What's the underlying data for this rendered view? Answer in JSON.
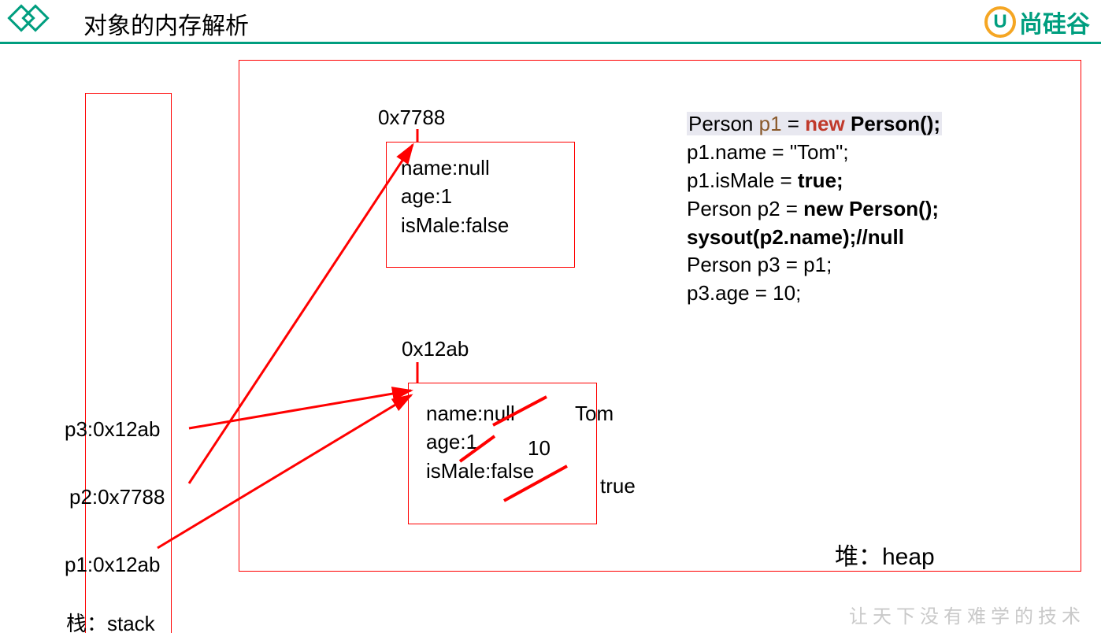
{
  "header": {
    "title": "对象的内存解析",
    "brand": "尚硅谷",
    "brand_letter": "U"
  },
  "stack": {
    "label": "栈：stack",
    "vars": {
      "p3": "p3:0x12ab",
      "p2": "p2:0x7788",
      "p1": "p1:0x12ab"
    }
  },
  "heap": {
    "label": "堆：heap",
    "obj1": {
      "addr": "0x7788",
      "name": "name:null",
      "age": "age:1",
      "isMale": "isMale:false"
    },
    "obj2": {
      "addr": "0x12ab",
      "name": "name:null",
      "age": "age:1",
      "isMale": "isMale:false",
      "name_new": "Tom",
      "age_new": "10",
      "isMale_new": "true"
    }
  },
  "code": {
    "l1a": "Person ",
    "l1b": "p1",
    "l1c": " = ",
    "l1d": "new",
    "l1e": " Person();",
    "l2a": "p1.name = \"Tom\";",
    "l3a": "p1.isMale = ",
    "l3b": "true;",
    "l4a": "Person p2 = ",
    "l4b": "new Person();",
    "l5": "sysout(p2.name);//null",
    "l6": "Person p3 = p1;",
    "l7": "p3.age = 10;"
  },
  "slogan": "让天下没有难学的技术"
}
